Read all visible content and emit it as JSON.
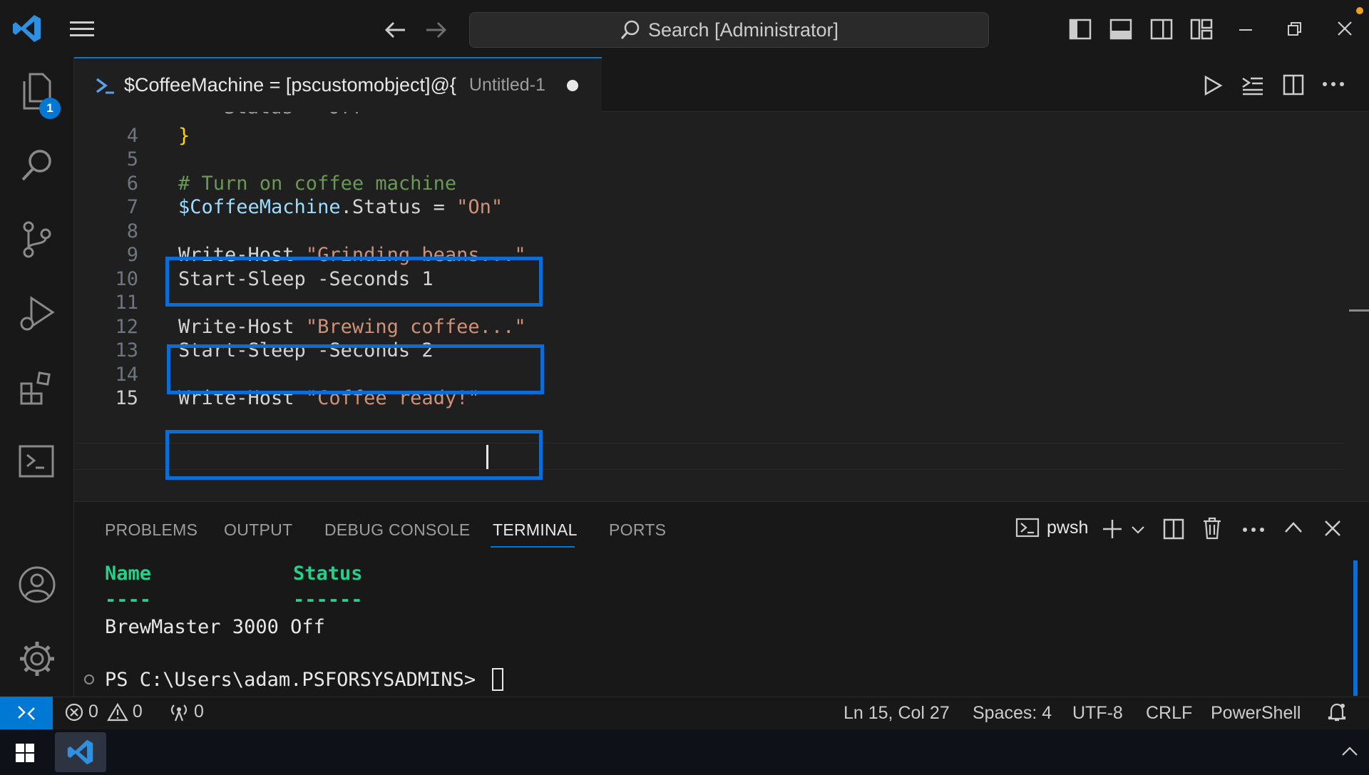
{
  "titlebar": {
    "search_text": "Search [Administrator]"
  },
  "activity": {
    "explorer_badge": "1"
  },
  "tab": {
    "title": "$CoffeeMachine = [pscustomobject]@{",
    "description": "Untitled-1"
  },
  "editor": {
    "lines": [
      {
        "n": "4",
        "text": "}"
      },
      {
        "n": "5",
        "text": ""
      },
      {
        "n": "6",
        "text": "# Turn on coffee machine"
      },
      {
        "n": "7",
        "var": "$CoffeeMachine",
        "rest": ".Status = ",
        "str": "\"On\""
      },
      {
        "n": "8",
        "text": ""
      },
      {
        "n": "9",
        "cmd": "Write-Host ",
        "str": "\"Grinding beans...\""
      },
      {
        "n": "10",
        "text": "Start-Sleep -Seconds 1"
      },
      {
        "n": "11",
        "text": ""
      },
      {
        "n": "12",
        "cmd": "Write-Host ",
        "str": "\"Brewing coffee...\""
      },
      {
        "n": "13",
        "text": "Start-Sleep -Seconds 2"
      },
      {
        "n": "14",
        "text": ""
      },
      {
        "n": "15",
        "cmd": "Write-Host ",
        "str": "\"Coffee ready!\""
      }
    ]
  },
  "panel": {
    "tabs": [
      "PROBLEMS",
      "OUTPUT",
      "DEBUG CONSOLE",
      "TERMINAL",
      "PORTS"
    ],
    "active_tab": "TERMINAL",
    "shell_name": "pwsh",
    "terminal": {
      "header_name": "Name",
      "header_status": "Status",
      "sep_name": "----",
      "sep_status": "------",
      "row": "BrewMaster 3000 Off",
      "prompt": "PS C:\\Users\\adam.PSFORSYSADMINS>"
    }
  },
  "statusbar": {
    "errors": "0",
    "warnings": "0",
    "ports": "0",
    "cursor_position": "Ln 15, Col 27",
    "indent": "Spaces: 4",
    "encoding": "UTF-8",
    "eol": "CRLF",
    "language": "PowerShell"
  }
}
